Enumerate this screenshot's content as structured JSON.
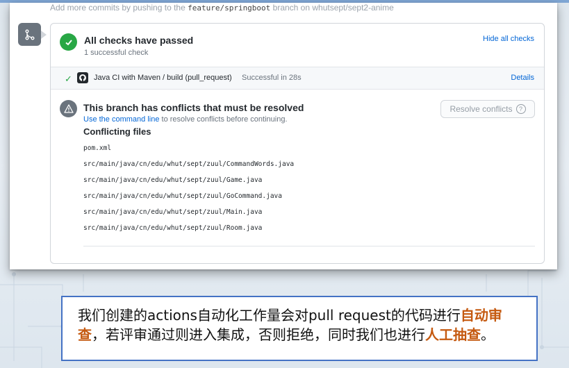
{
  "top_text": {
    "prefix": "Add more commits by pushing to the ",
    "branch": "feature/springboot",
    "middle": " branch on ",
    "repo": "whutsept/sept2-anime"
  },
  "checks": {
    "title": "All checks have passed",
    "subtitle": "1 successful check",
    "hide_label": "Hide all checks",
    "items": [
      {
        "name": "Java CI with Maven / build (pull_request)",
        "status": "Successful in 28s",
        "details_label": "Details"
      }
    ]
  },
  "conflicts": {
    "title": "This branch has conflicts that must be resolved",
    "subtitle_link": "Use the command line",
    "subtitle_rest": " to resolve conflicts before continuing.",
    "resolve_label": "Resolve conflicts",
    "help_glyph": "?",
    "files_title": "Conflicting files",
    "files": [
      "pom.xml",
      "src/main/java/cn/edu/whut/sept/zuul/CommandWords.java",
      "src/main/java/cn/edu/whut/sept/zuul/Game.java",
      "src/main/java/cn/edu/whut/sept/zuul/GoCommand.java",
      "src/main/java/cn/edu/whut/sept/zuul/Main.java",
      "src/main/java/cn/edu/whut/sept/zuul/Room.java"
    ]
  },
  "caption": {
    "part1": "我们创建的actions自动化工作量会对pull request的代码进行",
    "highlight1": "自动审查",
    "part2": "，若评审通过则进入集成，否则拒绝，同时我们也进行",
    "highlight2": "人工抽查",
    "part3": "。"
  },
  "icons": {
    "merge": "git-pull-request-icon",
    "success": "check-circle-icon",
    "row_check": "check-icon",
    "github": "github-logo-icon",
    "warning": "alert-icon",
    "help": "question-icon"
  },
  "colors": {
    "success": "#28a745",
    "link": "#0366d6",
    "neutral": "#6a737d",
    "highlight": "#c55a11",
    "caption_border": "#4472c4"
  }
}
